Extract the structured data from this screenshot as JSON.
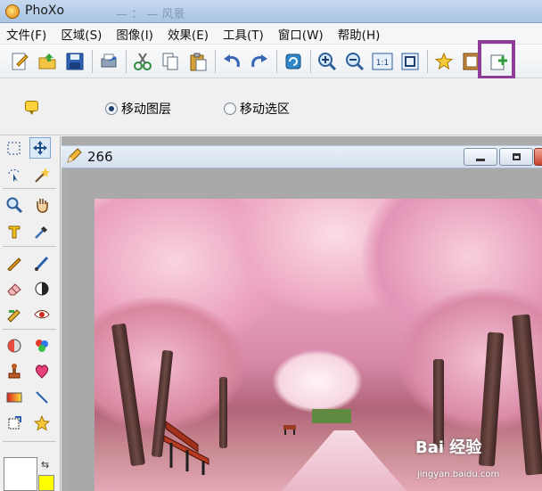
{
  "window": {
    "app_name": "PhoXo",
    "title_extra": "— ：  — 风景"
  },
  "menu": [
    "文件(F)",
    "区域(S)",
    "图像(I)",
    "效果(E)",
    "工具(T)",
    "窗口(W)",
    "帮助(H)"
  ],
  "toolbar": {
    "buttons": [
      "new-icon",
      "open-icon",
      "save-icon",
      "print-icon",
      "cut-icon",
      "copy-icon",
      "paste-icon",
      "undo-icon",
      "redo-icon",
      "refresh-icon",
      "zoom-in-icon",
      "zoom-out-icon",
      "actual-size-icon",
      "fit-window-icon",
      "favorite-icon",
      "frame-icon",
      "add-layer-icon"
    ],
    "actual_size_label": "1:1",
    "highlighted": "frame-icon",
    "highlight_color": "#8e3e98"
  },
  "options": {
    "move_layer_label": "移动图层",
    "move_selection_label": "移动选区",
    "selected": "move_layer"
  },
  "tools": [
    "rect-select-icon",
    "move-icon",
    "lasso-icon",
    "magic-wand-icon",
    "zoom-icon",
    "hand-icon",
    "text-icon",
    "eyedropper-icon",
    "pen-icon",
    "brush-icon",
    "eraser-icon",
    "contrast-icon",
    "clone-icon",
    "red-eye-icon",
    "dodge-icon",
    "color-replace-icon",
    "stamp-icon",
    "heart-shape-icon",
    "gradient-icon",
    "line-icon",
    "transform-icon",
    "star-icon"
  ],
  "colors": {
    "foreground": "#ffffff",
    "background": "#ffff00"
  },
  "document": {
    "title": "266"
  },
  "photo": {
    "watermark": "Bai 经验",
    "watermark_sub": "jingyan.baidu.com"
  }
}
